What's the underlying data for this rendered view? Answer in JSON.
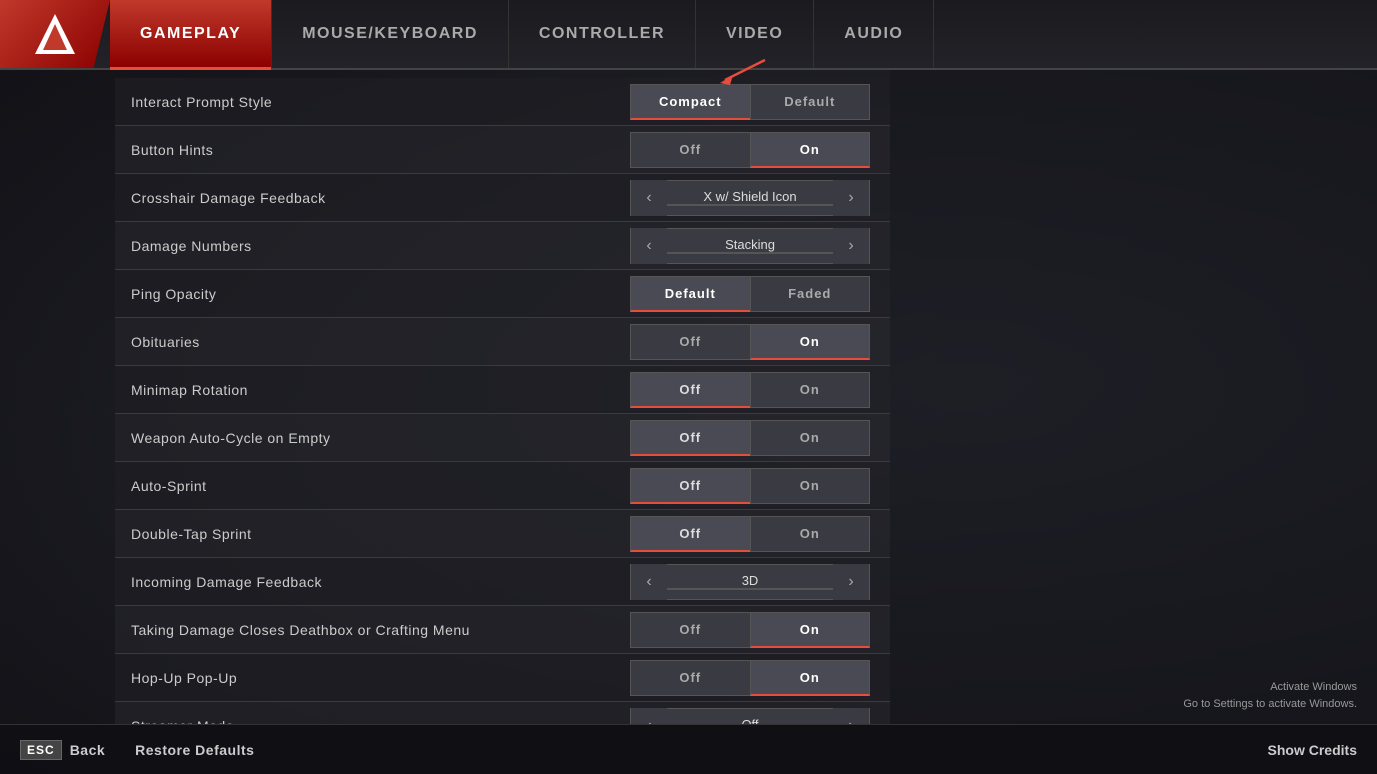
{
  "nav": {
    "tabs": [
      {
        "id": "gameplay",
        "label": "GAMEPLAY",
        "active": true
      },
      {
        "id": "mouse-keyboard",
        "label": "MOUSE/KEYBOARD",
        "active": false
      },
      {
        "id": "controller",
        "label": "CONTROLLER",
        "active": false
      },
      {
        "id": "video",
        "label": "VIDEO",
        "active": false
      },
      {
        "id": "audio",
        "label": "AUDIO",
        "active": false
      }
    ]
  },
  "settings": [
    {
      "id": "interact-prompt-style",
      "label": "Interact Prompt Style",
      "type": "two-option",
      "options": [
        "Compact",
        "Default"
      ],
      "selected": "Compact"
    },
    {
      "id": "button-hints",
      "label": "Button Hints",
      "type": "toggle",
      "selected": "On"
    },
    {
      "id": "crosshair-damage-feedback",
      "label": "Crosshair Damage Feedback",
      "type": "arrow-selector",
      "value": "X w/ Shield Icon"
    },
    {
      "id": "damage-numbers",
      "label": "Damage Numbers",
      "type": "arrow-selector",
      "value": "Stacking"
    },
    {
      "id": "ping-opacity",
      "label": "Ping Opacity",
      "type": "two-option",
      "options": [
        "Default",
        "Faded"
      ],
      "selected": "Default"
    },
    {
      "id": "obituaries",
      "label": "Obituaries",
      "type": "toggle",
      "selected": "On"
    },
    {
      "id": "minimap-rotation",
      "label": "Minimap Rotation",
      "type": "toggle",
      "selected": "Off"
    },
    {
      "id": "weapon-auto-cycle",
      "label": "Weapon Auto-Cycle on Empty",
      "type": "toggle",
      "selected": "Off"
    },
    {
      "id": "auto-sprint",
      "label": "Auto-Sprint",
      "type": "toggle",
      "selected": "Off"
    },
    {
      "id": "double-tap-sprint",
      "label": "Double-Tap Sprint",
      "type": "toggle",
      "selected": "Off"
    },
    {
      "id": "incoming-damage-feedback",
      "label": "Incoming Damage Feedback",
      "type": "arrow-selector",
      "value": "3D"
    },
    {
      "id": "taking-damage-closes",
      "label": "Taking Damage Closes Deathbox or Crafting Menu",
      "type": "toggle",
      "selected": "On"
    },
    {
      "id": "hop-up-popup",
      "label": "Hop-Up Pop-Up",
      "type": "toggle",
      "selected": "On"
    },
    {
      "id": "streamer-mode",
      "label": "Streamer Mode",
      "type": "arrow-selector",
      "value": "Off"
    }
  ],
  "bottom": {
    "esc_label": "ESC",
    "back_label": "Back",
    "restore_label": "Restore Defaults",
    "credits_label": "Show Credits"
  },
  "watermark": {
    "line1": "Activate Windows",
    "line2": "Go to Settings to activate Windows."
  }
}
